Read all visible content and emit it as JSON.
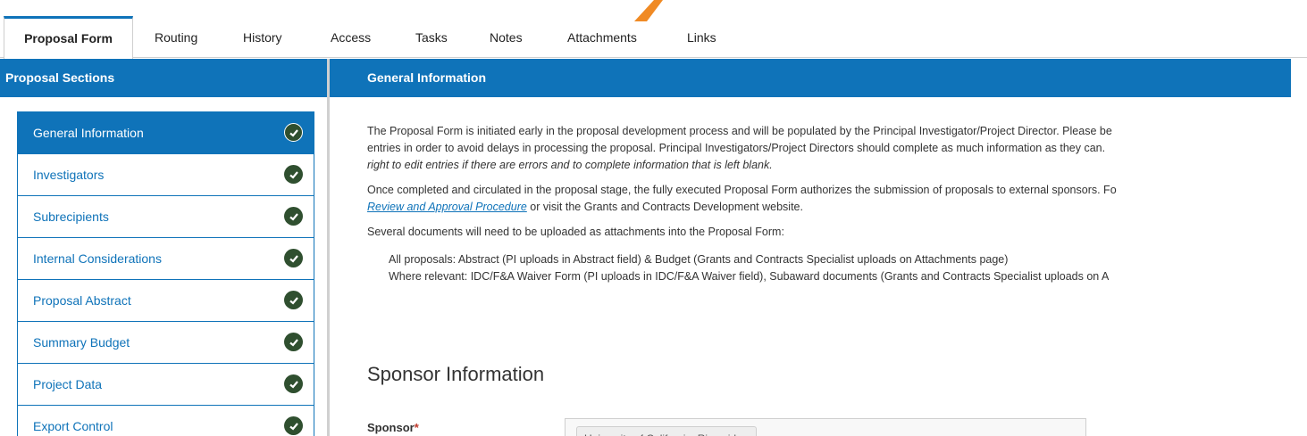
{
  "tabs": [
    {
      "label": "Proposal Form",
      "active": true
    },
    {
      "label": "Routing"
    },
    {
      "label": "History"
    },
    {
      "label": "Access"
    },
    {
      "label": "Tasks"
    },
    {
      "label": "Notes"
    },
    {
      "label": "Attachments"
    },
    {
      "label": "Links"
    }
  ],
  "sidebar": {
    "title": "Proposal Sections",
    "items": [
      {
        "label": "General Information",
        "active": true,
        "icon": "check-circle-icon"
      },
      {
        "label": "Investigators",
        "icon": "check-circle-icon"
      },
      {
        "label": "Subrecipients",
        "icon": "check-circle-icon"
      },
      {
        "label": "Internal Considerations",
        "icon": "check-circle-icon"
      },
      {
        "label": "Proposal Abstract",
        "icon": "check-circle-icon"
      },
      {
        "label": "Summary Budget",
        "icon": "check-circle-icon"
      },
      {
        "label": "Project Data",
        "icon": "check-circle-icon"
      },
      {
        "label": "Export Control",
        "icon": "check-circle-icon"
      }
    ]
  },
  "main": {
    "title": "General Information",
    "intro_line1": "The Proposal Form is initiated early in the proposal development process and will be populated by the Principal Investigator/Project Director. Please be",
    "intro_line2": "entries in order to avoid delays in processing the proposal.  Principal Investigators/Project Directors should complete as much information as they can.",
    "intro_line3": "right to edit entries if there are errors and to complete information that is left blank.",
    "para2_line1": "Once completed and circulated in the proposal stage, the fully executed Proposal Form  authorizes the submission of proposals to external sponsors.  Fo",
    "para2_link": "Review and Approval Procedure",
    "para2_rest": " or visit the Grants and Contracts Development website.",
    "para3": "Several documents will need to be uploaded as attachments into the Proposal Form:",
    "bullets": [
      "All proposals: Abstract (PI uploads in Abstract field) & Budget (Grants and Contracts Specialist uploads on Attachments page)",
      "Where relevant: IDC/F&A Waiver Form (PI uploads in IDC/F&A Waiver field), Subaward documents (Grants and Contracts Specialist uploads on A"
    ],
    "section_title": "Sponsor Information",
    "sponsor_label": "Sponsor",
    "sponsor_required": "*",
    "sponsor_value": "University of California, Riverside"
  },
  "colors": {
    "accent": "#0f73b9",
    "check": "#2f4f2f",
    "arrow": "#f08a24"
  }
}
